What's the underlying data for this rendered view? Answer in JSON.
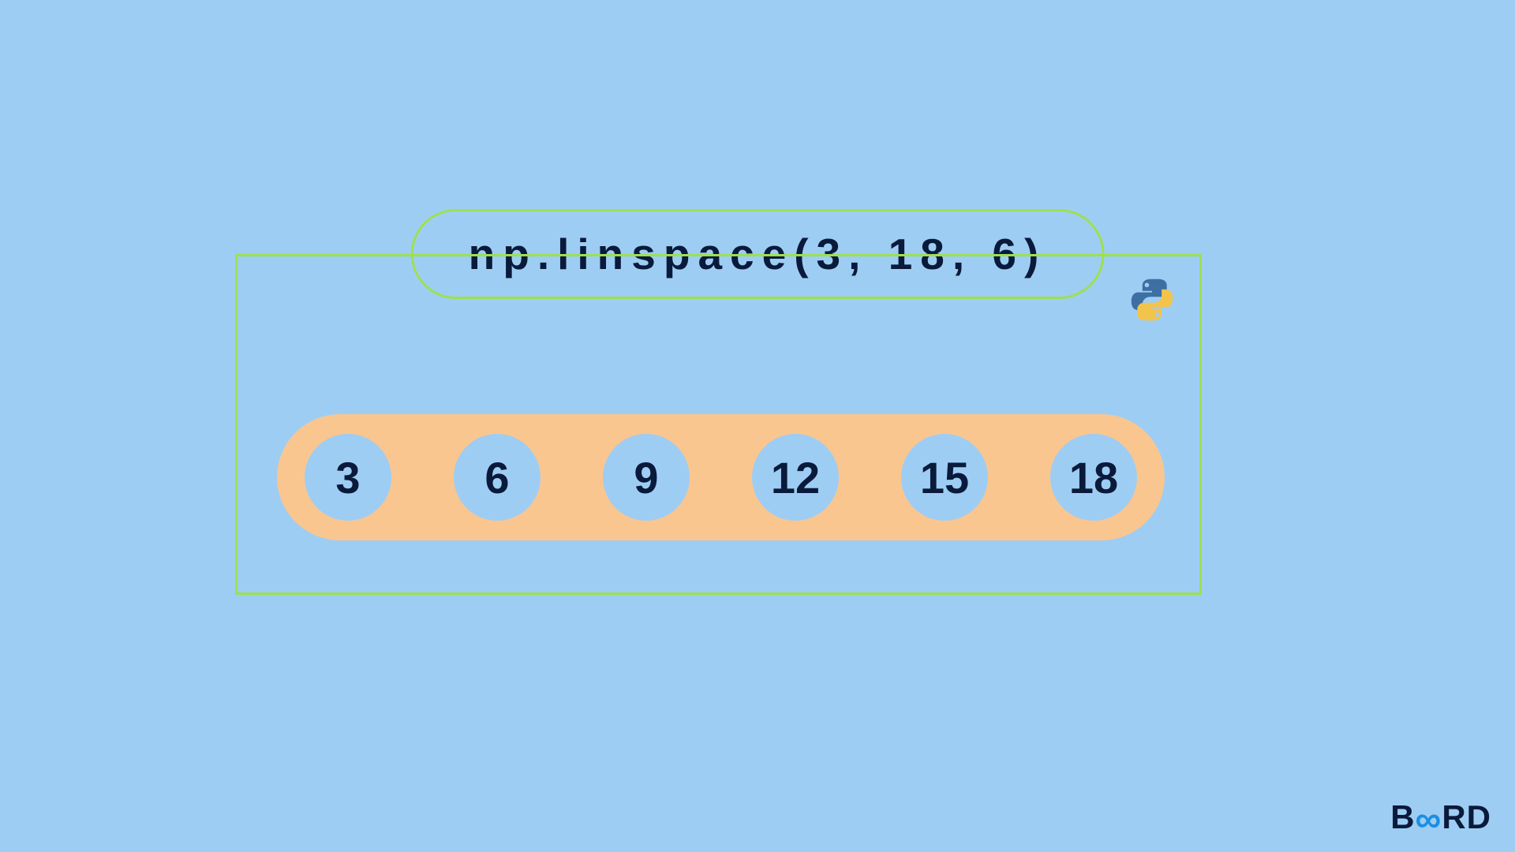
{
  "title": "np.linspace(3, 18, 6)",
  "values": [
    "3",
    "6",
    "9",
    "12",
    "15",
    "18"
  ],
  "brand": {
    "left": "B",
    "right": "RD",
    "inf": "∞"
  },
  "icons": {
    "python": "python-icon"
  },
  "colors": {
    "bg": "#9ecdf4",
    "border": "#9de04f",
    "pill": "#f9c690",
    "text": "#0a1a3a",
    "brand_accent": "#1a8fe3"
  }
}
